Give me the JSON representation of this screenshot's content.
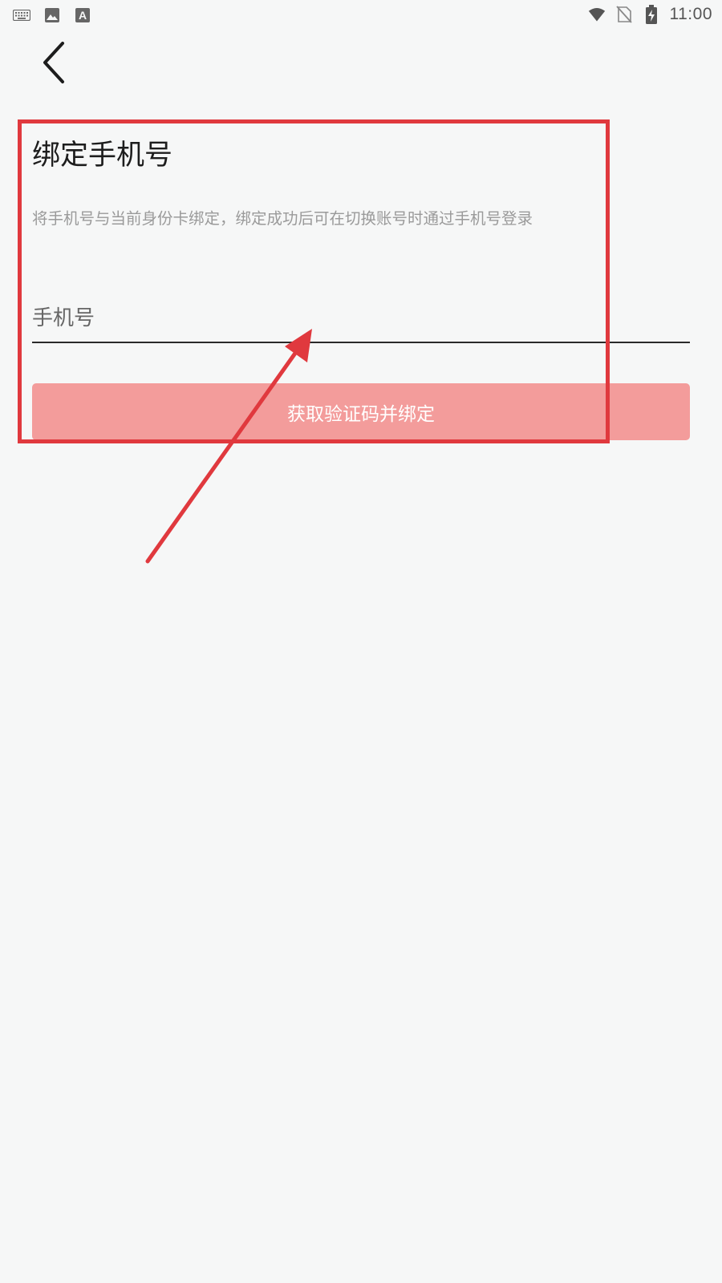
{
  "status_bar": {
    "time": "11:00",
    "left_icons": [
      "keyboard-icon",
      "image-icon",
      "font-icon"
    ],
    "right_icons": [
      "wifi-icon",
      "no-sim-icon",
      "battery-charging-icon"
    ]
  },
  "header": {
    "back_icon": "chevron-left-icon"
  },
  "main": {
    "title": "绑定手机号",
    "description": "将手机号与当前身份卡绑定，绑定成功后可在切换账号时通过手机号登录",
    "phone_input": {
      "placeholder": "手机号",
      "value": ""
    },
    "bind_button_label": "获取验证码并绑定"
  },
  "annotation": {
    "color": "#e0393e"
  },
  "colors": {
    "background": "#f6f7f7",
    "button_disabled": "#f39c9b",
    "annotation": "#e0393e"
  }
}
